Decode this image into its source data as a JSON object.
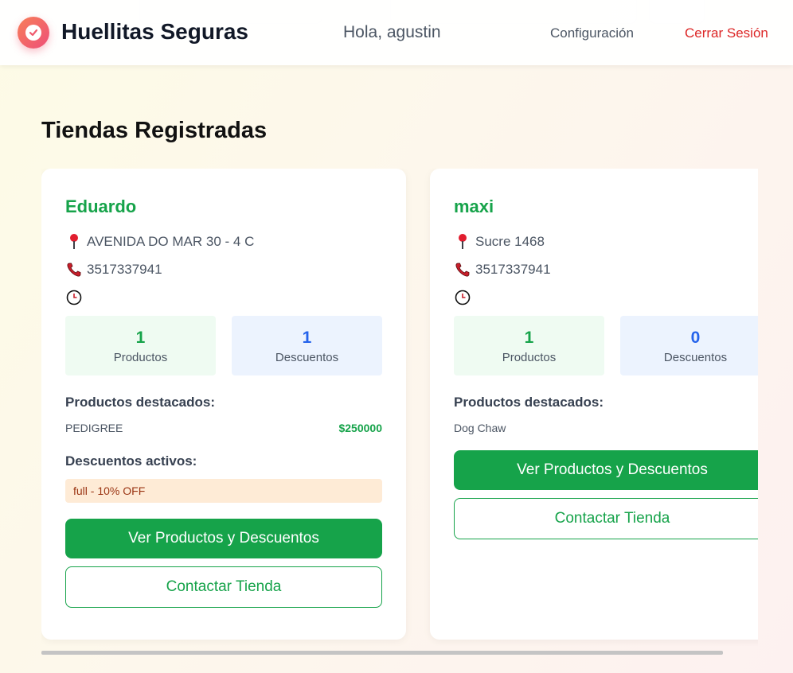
{
  "app": {
    "brand": "Huellitas Seguras",
    "greeting": "Hola, agustin",
    "nav": {
      "config": "Configuración",
      "logout": "Cerrar Sesión"
    }
  },
  "page": {
    "title": "Tiendas Registradas"
  },
  "stores": [
    {
      "name": "Eduardo",
      "address": "AVENIDA DO MAR 30 - 4 C",
      "phone": "3517337941",
      "hours": "",
      "products_count": "1",
      "products_label": "Productos",
      "discounts_count": "1",
      "discounts_label": "Descuentos",
      "featured_title": "Productos destacados:",
      "featured": [
        {
          "name": "PEDIGREE",
          "price": "$250000"
        }
      ],
      "discounts_title": "Descuentos activos:",
      "active_discounts": [
        "full - 10% OFF"
      ],
      "primary_button": "Ver Productos y Descuentos",
      "secondary_button": "Contactar Tienda"
    },
    {
      "name": "maxi",
      "address": "Sucre 1468",
      "phone": "3517337941",
      "hours": "",
      "products_count": "1",
      "products_label": "Productos",
      "discounts_count": "0",
      "discounts_label": "Descuentos",
      "featured_title": "Productos destacados:",
      "featured": [
        {
          "name": "Dog Chaw",
          "price": "$"
        }
      ],
      "primary_button": "Ver Productos y Descuentos",
      "secondary_button": "Contactar Tienda"
    }
  ],
  "colors": {
    "accent": "#16a34a",
    "accent_blue": "#2563eb",
    "logout": "#dc2626",
    "discount_bg": "#feebd6"
  },
  "icons": {
    "logo": "check-badge-icon",
    "address": "map-pin-icon",
    "phone": "phone-icon",
    "hours": "clock-icon"
  }
}
